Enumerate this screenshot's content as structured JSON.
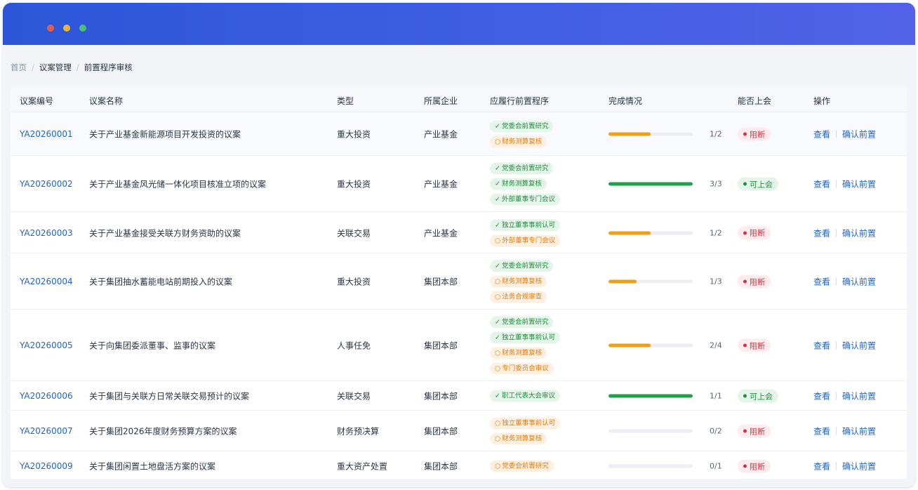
{
  "window": {
    "dots": [
      "close",
      "minimize",
      "maximize"
    ]
  },
  "breadcrumb": {
    "home": "首页",
    "section": "议案管理",
    "current": "前置程序审核"
  },
  "table": {
    "headers": {
      "id": "议案编号",
      "name": "议案名称",
      "type": "类型",
      "enterprise": "所属企业",
      "procedures": "应履行前置程序",
      "progress": "完成情况",
      "meeting": "能否上会",
      "actions": "操作"
    },
    "actions": {
      "view": "查看",
      "confirm": "确认前置"
    },
    "rows": [
      {
        "id": "YA20260001",
        "name": "关于产业基金新能源项目开发投资的议案",
        "type": "重大投资",
        "enterprise": "产业基金",
        "procedures": [
          {
            "mark": "✓",
            "label": "党委会前置研究",
            "done": true
          },
          {
            "mark": "○",
            "label": "财务测算复核",
            "done": false
          }
        ],
        "progress": 0.5,
        "progress_text": "1/2",
        "status": "阻断",
        "can_meet": false
      },
      {
        "id": "YA20260002",
        "name": "关于产业基金风光储一体化项目核准立项的议案",
        "type": "重大投资",
        "enterprise": "产业基金",
        "procedures": [
          {
            "mark": "✓",
            "label": "党委会前置研究",
            "done": true
          },
          {
            "mark": "✓",
            "label": "财务测算复核",
            "done": true
          },
          {
            "mark": "✓",
            "label": "外部董事专门会议",
            "done": true
          }
        ],
        "progress": 1,
        "progress_text": "3/3",
        "status": "可上会",
        "can_meet": true
      },
      {
        "id": "YA20260003",
        "name": "关于产业基金接受关联方财务资助的议案",
        "type": "关联交易",
        "enterprise": "产业基金",
        "procedures": [
          {
            "mark": "✓",
            "label": "独立董事事前认可",
            "done": true
          },
          {
            "mark": "○",
            "label": "外部董事专门会议",
            "done": false
          }
        ],
        "progress": 0.5,
        "progress_text": "1/2",
        "status": "阻断",
        "can_meet": false
      },
      {
        "id": "YA20260004",
        "name": "关于集团抽水蓄能电站前期投入的议案",
        "type": "重大投资",
        "enterprise": "集团本部",
        "procedures": [
          {
            "mark": "✓",
            "label": "党委会前置研究",
            "done": true
          },
          {
            "mark": "○",
            "label": "财务测算复核",
            "done": false
          },
          {
            "mark": "○",
            "label": "法务合规审查",
            "done": false
          }
        ],
        "progress": 0.333,
        "progress_text": "1/3",
        "status": "阻断",
        "can_meet": false
      },
      {
        "id": "YA20260005",
        "name": "关于向集团委派董事、监事的议案",
        "type": "人事任免",
        "enterprise": "集团本部",
        "procedures": [
          {
            "mark": "✓",
            "label": "党委会前置研究",
            "done": true
          },
          {
            "mark": "✓",
            "label": "独立董事事前认可",
            "done": true
          },
          {
            "mark": "○",
            "label": "财务测算复核",
            "done": false
          },
          {
            "mark": "○",
            "label": "专门委员会审议",
            "done": false
          }
        ],
        "progress": 0.5,
        "progress_text": "2/4",
        "status": "阻断",
        "can_meet": false
      },
      {
        "id": "YA20260006",
        "name": "关于集团与关联方日常关联交易预计的议案",
        "type": "关联交易",
        "enterprise": "集团本部",
        "procedures": [
          {
            "mark": "✓",
            "label": "职工代表大会审议",
            "done": true
          }
        ],
        "progress": 1,
        "progress_text": "1/1",
        "status": "可上会",
        "can_meet": true
      },
      {
        "id": "YA20260007",
        "name": "关于集团2026年度财务预算方案的议案",
        "type": "财务预决算",
        "enterprise": "集团本部",
        "procedures": [
          {
            "mark": "○",
            "label": "独立董事事前认可",
            "done": false
          },
          {
            "mark": "○",
            "label": "财务测算复核",
            "done": false
          }
        ],
        "progress": 0,
        "progress_text": "0/2",
        "status": "阻断",
        "can_meet": false
      },
      {
        "id": "YA20260009",
        "name": "关于集团闲置土地盘活方案的议案",
        "type": "重大资产处置",
        "enterprise": "集团本部",
        "procedures": [
          {
            "mark": "○",
            "label": "党委会前置研究",
            "done": false
          }
        ],
        "progress": 0,
        "progress_text": "0/1",
        "status": "阻断",
        "can_meet": false
      }
    ]
  }
}
